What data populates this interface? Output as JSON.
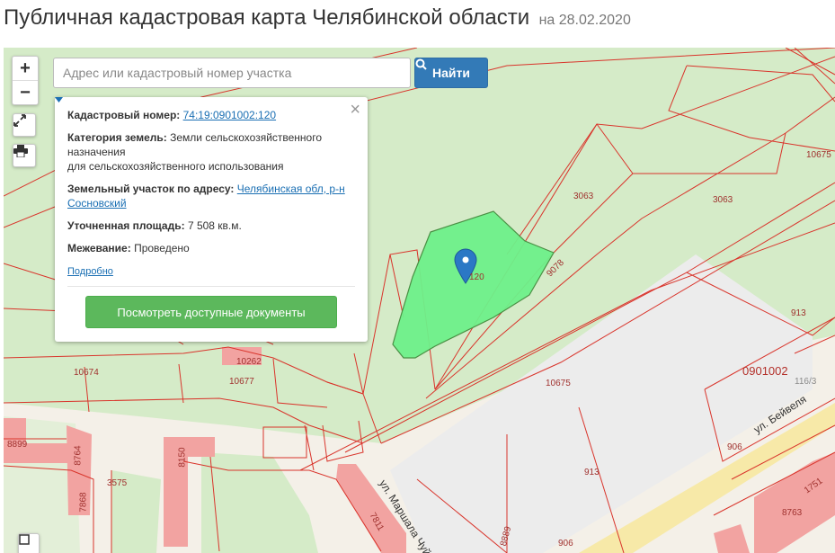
{
  "header": {
    "title": "Публичная кадастровая карта Челябинской области",
    "date": "на 28.02.2020"
  },
  "search": {
    "placeholder": "Адрес или кадастровый номер участка",
    "button_label": "Найти"
  },
  "controls": {
    "zoom_in": "+",
    "zoom_out": "−"
  },
  "popup": {
    "cadastral_label": "Кадастровый номер:",
    "cadastral_value": "74:19:0901002:120",
    "category_label": "Категория земель:",
    "category_value": "Земли сельскохозяйственного назначения",
    "category_value2": "для сельскохозяйственного использования",
    "address_label": "Земельный участок по адресу:",
    "address_value": "Челябинская обл, р-н Сосновский",
    "area_label": "Уточненная площадь:",
    "area_value": "7 508 кв.м.",
    "survey_label": "Межевание:",
    "survey_value": "Проведено",
    "more_link": "Подробно",
    "docs_button": "Посмотреть доступные документы",
    "close": "×"
  },
  "map": {
    "selected_parcel_label": "120",
    "quarter_label": "0901002",
    "parcel_labels": [
      "10675",
      "3063",
      "3063",
      "9078",
      "913",
      "10675",
      "116/3",
      "10674",
      "10262",
      "10677",
      "906",
      "8899",
      "8764",
      "8150",
      "3575",
      "7868",
      "913",
      "7811",
      "8889",
      "906",
      "8763",
      "1751"
    ],
    "streets": [
      "ул. Бейвеля",
      "ул. Маршала Чуйкова"
    ]
  },
  "colors": {
    "parcel_line": "#d9342b",
    "selected_fill": "#6ef08a",
    "green_area": "#d5ebc8",
    "building": "#f2a3a1",
    "search_button": "#337ab7",
    "docs_button": "#5cb85c"
  }
}
